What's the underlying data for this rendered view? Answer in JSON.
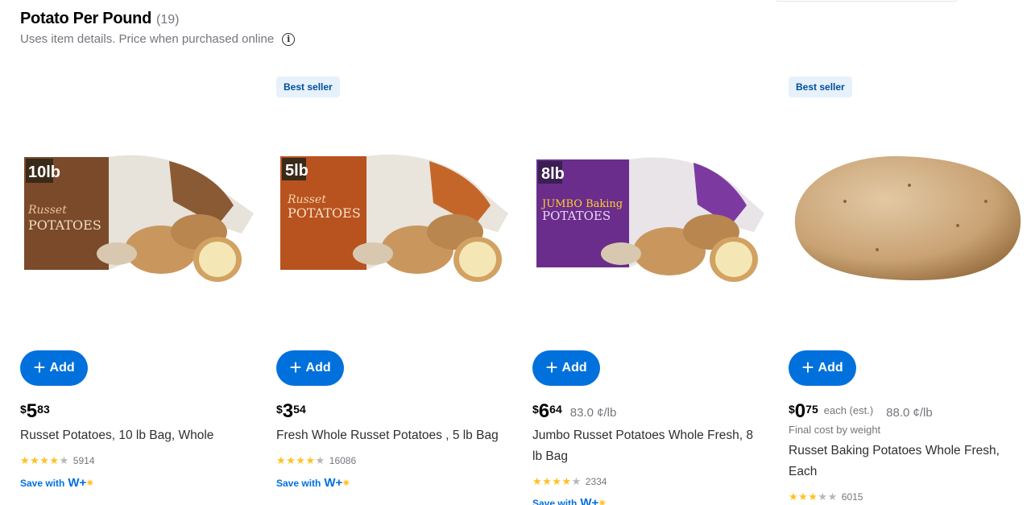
{
  "header": {
    "title": "Potato Per Pound",
    "count": "(19)",
    "subtitle": "Uses item details. Price when purchased online",
    "info_icon": "info-icon"
  },
  "products": [
    {
      "badge": "",
      "add_label": "Add",
      "price_currency": "$",
      "price_dollars": "5",
      "price_cents": "83",
      "each_label": "",
      "unit_price": "",
      "final_cost": "",
      "name": "Russet Potatoes, 10 lb Bag, Whole",
      "rating": 4,
      "reviews": "5914",
      "save_label": "Save with",
      "package_label": "10lb",
      "package_text": "Russet POTATOES"
    },
    {
      "badge": "Best seller",
      "add_label": "Add",
      "price_currency": "$",
      "price_dollars": "3",
      "price_cents": "54",
      "each_label": "",
      "unit_price": "",
      "final_cost": "",
      "name": "Fresh Whole Russet Potatoes , 5 lb Bag",
      "rating": 4,
      "reviews": "16086",
      "save_label": "Save with",
      "package_label": "5lb",
      "package_text": "Russet POTATOES"
    },
    {
      "badge": "",
      "add_label": "Add",
      "price_currency": "$",
      "price_dollars": "6",
      "price_cents": "64",
      "each_label": "",
      "unit_price": "83.0 ¢/lb",
      "final_cost": "",
      "name": "Jumbo Russet Potatoes Whole Fresh, 8 lb Bag",
      "rating": 4,
      "reviews": "2334",
      "save_label": "Save with",
      "package_label": "8lb",
      "package_text": "JUMBO Baking POTATOES"
    },
    {
      "badge": "Best seller",
      "add_label": "Add",
      "price_currency": "$",
      "price_dollars": "0",
      "price_cents": "75",
      "each_label": "each (est.)",
      "unit_price": "88.0 ¢/lb",
      "final_cost": "Final cost by weight",
      "name": "Russet Baking Potatoes Whole Fresh, Each",
      "rating": 3,
      "reviews": "6015",
      "save_label": "",
      "package_label": "",
      "package_text": ""
    }
  ],
  "colors": {
    "primary": "#0071dc",
    "star": "#ffc220",
    "badge_bg": "#e6f1fc",
    "badge_text": "#004f9a"
  }
}
